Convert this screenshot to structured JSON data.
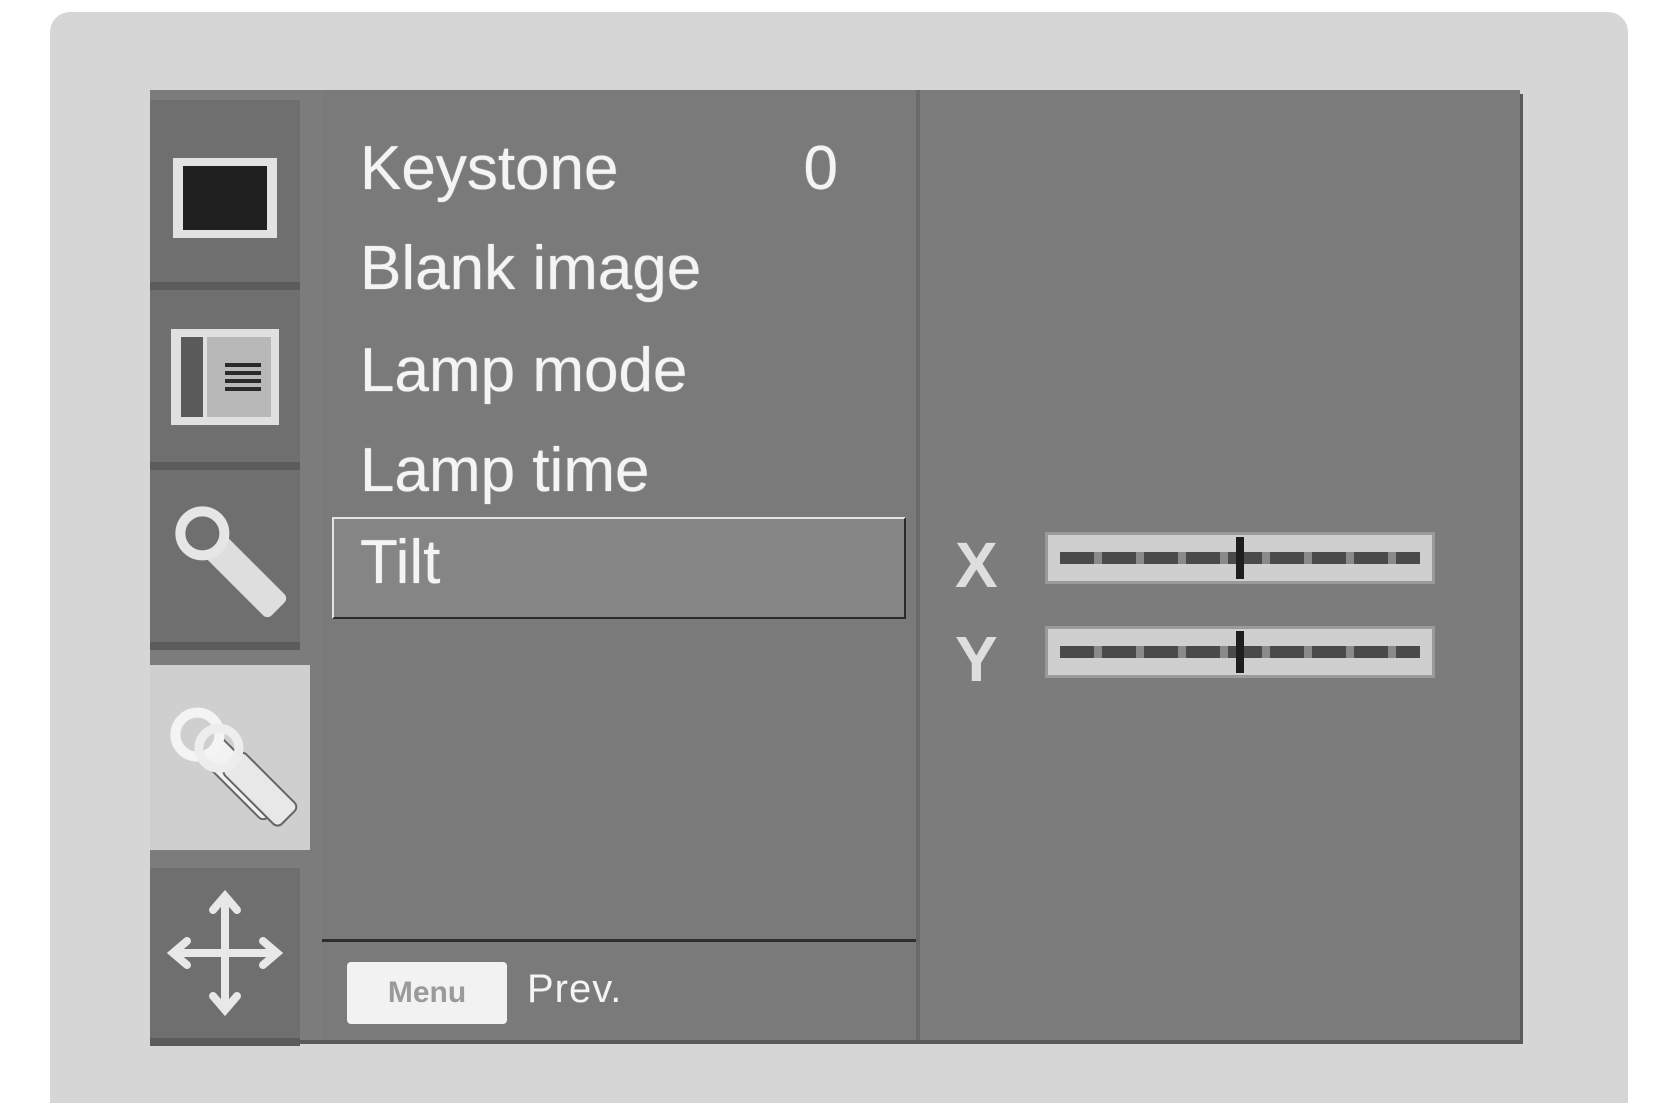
{
  "menu": {
    "items": [
      {
        "label": "Keystone",
        "value": "0"
      },
      {
        "label": "Blank image",
        "value": ""
      },
      {
        "label": "Lamp mode",
        "value": ""
      },
      {
        "label": "Lamp time",
        "value": ""
      },
      {
        "label": "Tilt",
        "value": ""
      }
    ],
    "selected_index": 4
  },
  "footer": {
    "key_label": "Menu",
    "action_label": "Prev."
  },
  "tabs": [
    {
      "icon": "screen-icon"
    },
    {
      "icon": "picture-settings-icon"
    },
    {
      "icon": "wrench-icon"
    },
    {
      "icon": "wrenches-icon",
      "active": true
    },
    {
      "icon": "position-arrows-icon"
    }
  ],
  "tilt": {
    "x_label": "X",
    "y_label": "Y",
    "x_level": 0.5,
    "y_level": 0.5
  },
  "colors": {
    "panel": "#7a7a7a",
    "bezel": "#d6d6d6",
    "text": "#f4f4f4",
    "active_tab": "#cfcfcf"
  }
}
